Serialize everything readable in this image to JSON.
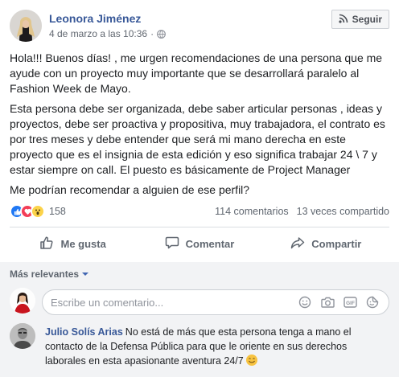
{
  "post": {
    "author": "Leonora Jiménez",
    "timestamp": "4 de marzo a las 10:36",
    "separator": "·",
    "follow_label": "Seguir",
    "paragraphs": [
      "Hola!!! Buenos días! , me urgen recomendaciones de una persona que me ayude con un proyecto muy importante que se desarrollará paralelo al Fashion Week de Mayo.",
      "Esta persona debe ser organizada, debe saber articular personas , ideas y proyectos, debe ser proactiva y propositiva, muy trabajadora, el contrato es por tres meses y debe entender que será mi mano derecha en este proyecto que es el insignia de esta edición y eso significa trabajar 24 \\ 7 y estar siempre on call. El puesto es básicamente de Project Manager",
      "Me podrían recomendar a alguien de ese perfil?"
    ]
  },
  "stats": {
    "reaction_count": "158",
    "comments": "114 comentarios",
    "shares": "13 veces compartido",
    "reactions": [
      "like-icon",
      "love-icon",
      "wow-icon"
    ]
  },
  "actions": {
    "like": "Me gusta",
    "comment": "Comentar",
    "share": "Compartir"
  },
  "comments_section": {
    "sort_label": "Más relevantes",
    "composer_placeholder": "Escribe un comentario...",
    "composer_icons": [
      "emoji-icon",
      "camera-icon",
      "gif-icon",
      "sticker-icon"
    ],
    "comments": [
      {
        "author": "Julio Solís Arias",
        "text": "No está de más que esta persona tenga a mano el contacto de la Defensa Pública para que le oriente en sus derechos laborales en esta apasionante aventura 24/7"
      }
    ]
  },
  "colors": {
    "link_blue": "#385898",
    "text": "#1c1e21",
    "muted": "#606770",
    "like_blue": "#2078f4",
    "love_red": "#f33e58",
    "wow_yellow": "#fcd34a"
  }
}
